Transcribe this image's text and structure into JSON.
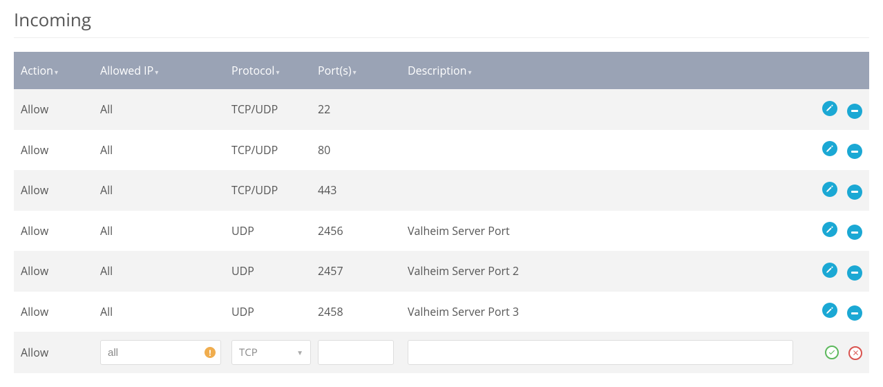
{
  "title": "Incoming",
  "columns": {
    "action": "Action",
    "allowed_ip": "Allowed IP",
    "protocol": "Protocol",
    "ports": "Port(s)",
    "description": "Description"
  },
  "rows": [
    {
      "action": "Allow",
      "allowed_ip": "All",
      "protocol": "TCP/UDP",
      "ports": "22",
      "description": ""
    },
    {
      "action": "Allow",
      "allowed_ip": "All",
      "protocol": "TCP/UDP",
      "ports": "80",
      "description": ""
    },
    {
      "action": "Allow",
      "allowed_ip": "All",
      "protocol": "TCP/UDP",
      "ports": "443",
      "description": ""
    },
    {
      "action": "Allow",
      "allowed_ip": "All",
      "protocol": "UDP",
      "ports": "2456",
      "description": "Valheim Server Port"
    },
    {
      "action": "Allow",
      "allowed_ip": "All",
      "protocol": "UDP",
      "ports": "2457",
      "description": "Valheim Server Port 2"
    },
    {
      "action": "Allow",
      "allowed_ip": "All",
      "protocol": "UDP",
      "ports": "2458",
      "description": "Valheim Server Port 3"
    }
  ],
  "new_rule": {
    "action": "Allow",
    "allowed_ip_value": "all",
    "protocol_value": "TCP",
    "ports_value": "",
    "description_value": ""
  },
  "icons": {
    "edit": "pencil-icon",
    "remove": "minus-icon",
    "confirm": "check-icon",
    "cancel": "x-icon",
    "warning": "warning-icon"
  }
}
